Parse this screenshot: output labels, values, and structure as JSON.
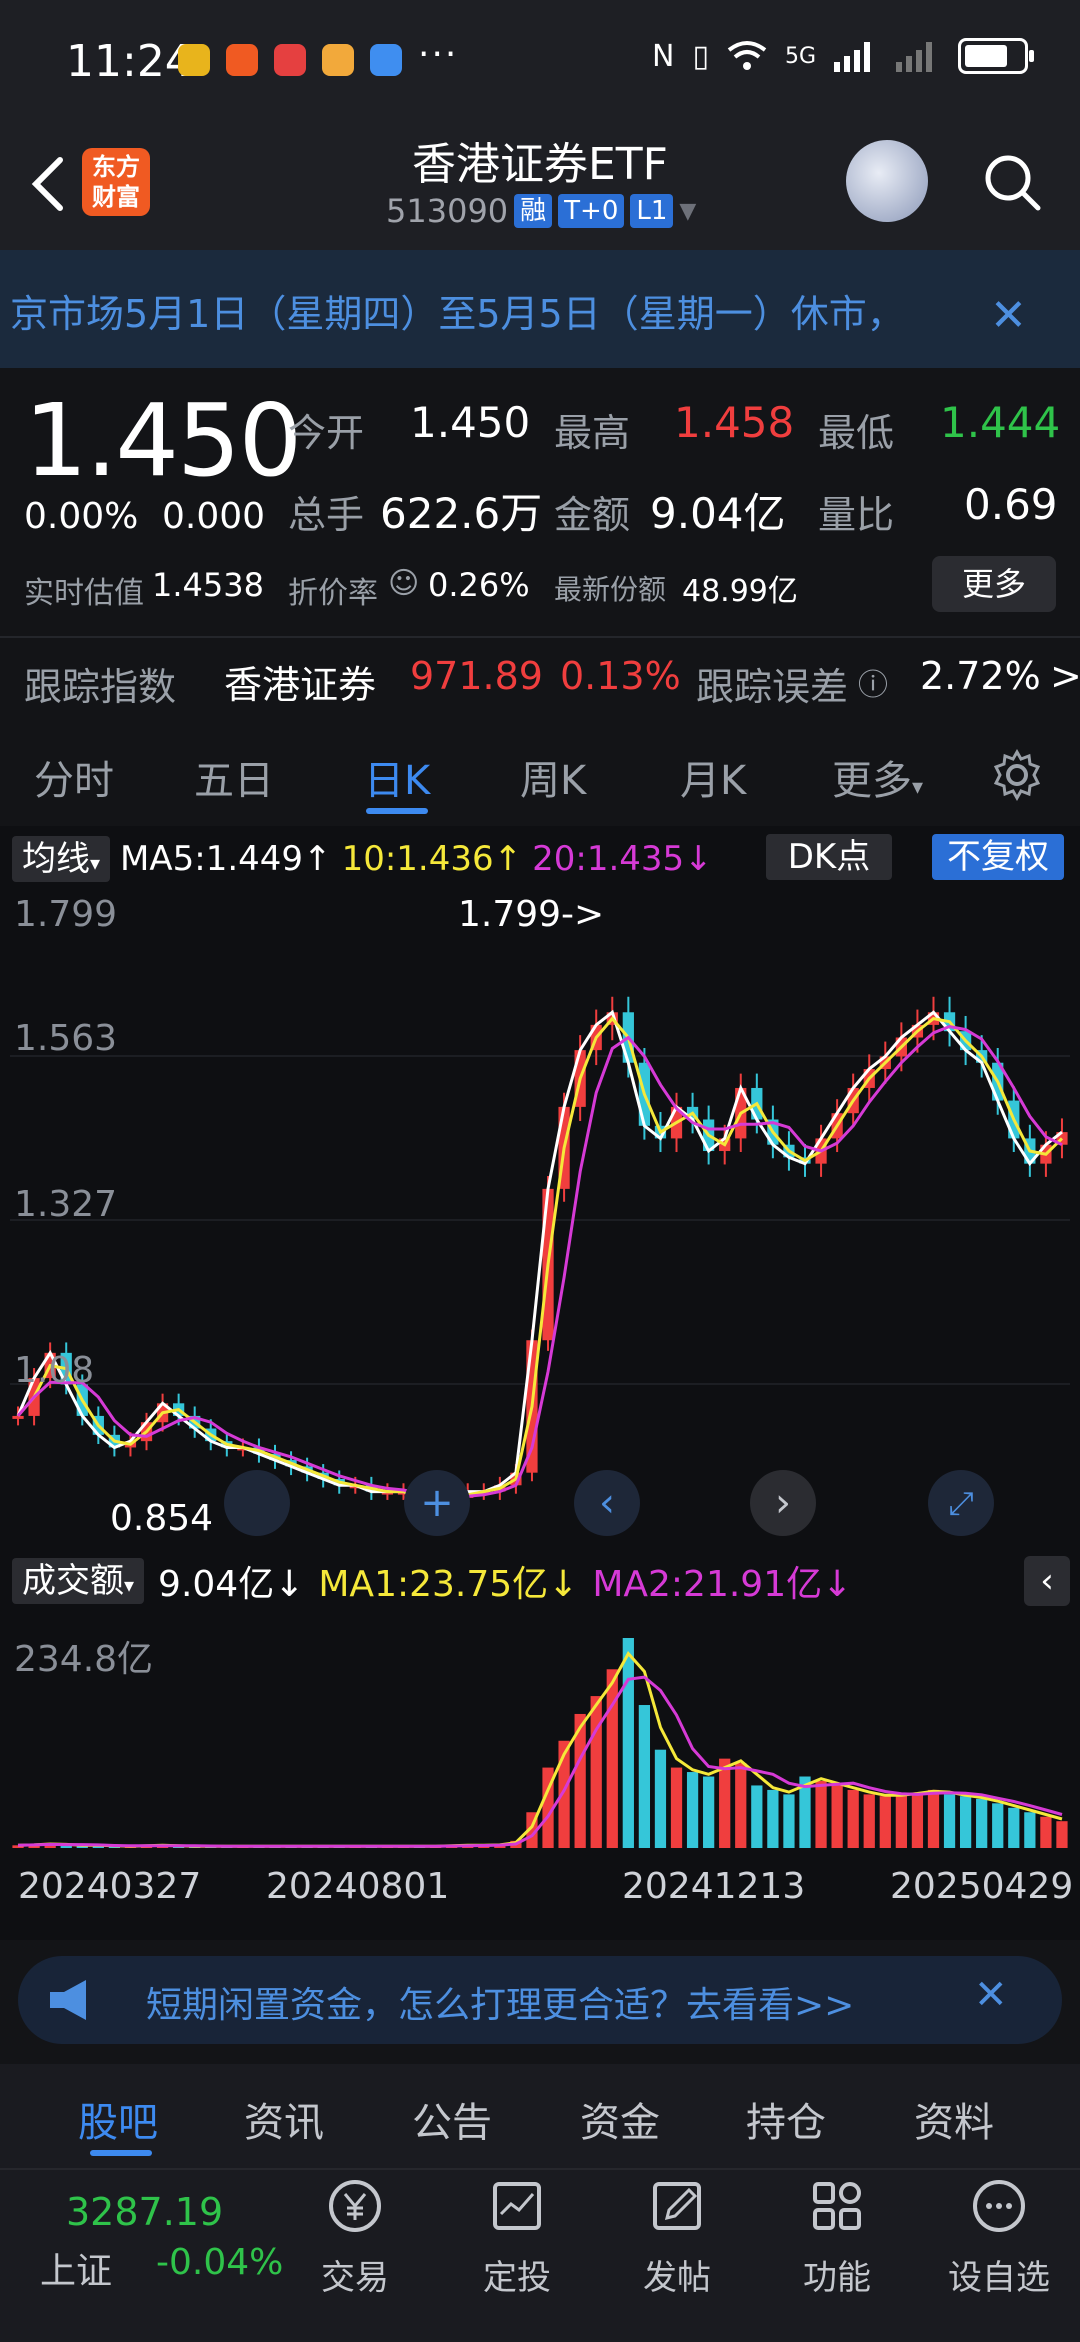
{
  "status": {
    "time": "11:24",
    "dots": "···",
    "network": "5G"
  },
  "header": {
    "back_label": "返回",
    "logo_text_1": "东方",
    "logo_text_2": "财富",
    "title": "香港证券ETF",
    "code": "513090",
    "tags": [
      "融",
      "T+0",
      "L1"
    ]
  },
  "notice": {
    "text": "京市场5月1日（星期四）至5月5日（星期一）休市，"
  },
  "quote": {
    "price": "1.450",
    "change_pct": "0.00%",
    "change": "0.000",
    "open_label": "今开",
    "open": "1.450",
    "high_label": "最高",
    "high": "1.458",
    "low_label": "最低",
    "low": "1.444",
    "volume_label": "总手",
    "volume": "622.6万",
    "amount_label": "金额",
    "amount": "9.04亿",
    "ratio_label": "量比",
    "ratio": "0.69",
    "nav_label": "实时估值",
    "nav": "1.4538",
    "premium_label": "折价率",
    "premium": "0.26%",
    "shares_label": "最新份额",
    "shares": "48.99亿",
    "more_btn": "更多"
  },
  "tracking": {
    "label": "跟踪指数",
    "index_name": "香港证券",
    "index_value": "971.89",
    "index_change": "0.13%",
    "error_label": "跟踪误差",
    "error_value": "2.72%",
    "arrow": ">"
  },
  "chart_tabs": [
    "分时",
    "五日",
    "日K",
    "周K",
    "月K",
    "更多"
  ],
  "active_chart_tab": "日K",
  "ma": {
    "selector": "均线",
    "ma5": "MA5:1.449↑",
    "ma10": "10:1.436↑",
    "ma20": "20:1.435↓",
    "dk": "DK点",
    "fq": "不复权"
  },
  "kline": {
    "y_ticks": [
      "1.799",
      "1.563",
      "1.327",
      "1.08",
      "0.854"
    ],
    "max_label": "1.799->",
    "min_label": "0.854"
  },
  "volume": {
    "selector": "成交额",
    "value": "9.04亿↓",
    "ma1": "MA1:23.75亿↓",
    "ma2": "MA2:21.91亿↓",
    "top": "234.8亿"
  },
  "x_labels": [
    "20240327",
    "20240801",
    "20241213",
    "20250429"
  ],
  "ad": {
    "text": "短期闲置资金，怎么打理更合适？去看看>>"
  },
  "bottom_tabs": [
    "股吧",
    "资讯",
    "公告",
    "资金",
    "持仓",
    "资料"
  ],
  "nav": {
    "index_value": "3287.19",
    "index_name": "上证",
    "index_change": "-0.04%",
    "items": [
      "交易",
      "定投",
      "发帖",
      "功能",
      "设自选"
    ]
  },
  "colors": {
    "up": "#f03e3e",
    "down": "#2fc34a",
    "accent": "#3d8af0",
    "ma5": "#ffffff",
    "ma10": "#f5e83a",
    "ma20": "#d63ad6",
    "bar_down": "#35c6d9"
  },
  "chart_data": {
    "type": "candlestick",
    "x_range": [
      "20240327",
      "20250429"
    ],
    "ylim": [
      0.854,
      1.799
    ],
    "close_trend": [
      1.0,
      1.06,
      1.1,
      1.05,
      1.0,
      0.97,
      0.95,
      0.96,
      0.99,
      1.02,
      1.0,
      0.98,
      0.96,
      0.95,
      0.95,
      0.94,
      0.93,
      0.92,
      0.91,
      0.9,
      0.89,
      0.89,
      0.88,
      0.88,
      0.88,
      0.87,
      0.87,
      0.87,
      0.88,
      0.88,
      0.89,
      0.91,
      1.12,
      1.36,
      1.49,
      1.58,
      1.62,
      1.64,
      1.56,
      1.46,
      1.44,
      1.49,
      1.47,
      1.42,
      1.44,
      1.52,
      1.47,
      1.43,
      1.41,
      1.4,
      1.44,
      1.48,
      1.52,
      1.55,
      1.57,
      1.6,
      1.62,
      1.64,
      1.61,
      1.58,
      1.56,
      1.5,
      1.44,
      1.4,
      1.43,
      1.45
    ],
    "volume_trend": [
      3,
      4,
      5,
      3,
      3,
      3,
      2,
      2,
      3,
      3,
      2,
      2,
      2,
      2,
      2,
      2,
      2,
      2,
      2,
      2,
      2,
      2,
      2,
      2,
      2,
      2,
      2,
      3,
      3,
      3,
      4,
      8,
      40,
      90,
      120,
      150,
      170,
      200,
      235,
      160,
      110,
      90,
      85,
      80,
      100,
      95,
      70,
      65,
      60,
      80,
      75,
      70,
      65,
      60,
      58,
      60,
      62,
      65,
      60,
      58,
      55,
      50,
      45,
      40,
      35,
      30
    ]
  }
}
